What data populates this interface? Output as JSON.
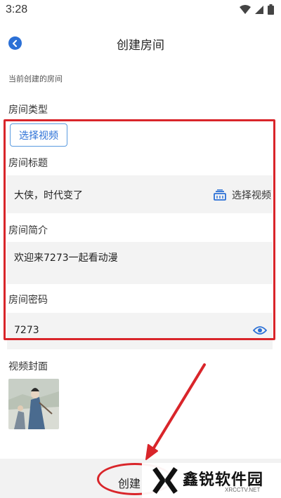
{
  "status": {
    "time": "3:28"
  },
  "header": {
    "title": "创建房间"
  },
  "section_hint": "当前创建的房间",
  "room_type": {
    "label": "房间类型",
    "button": "选择视频"
  },
  "room_title": {
    "label": "房间标题",
    "value": "大侠，时代变了",
    "action": "选择视频"
  },
  "room_intro": {
    "label": "房间简介",
    "value": "欢迎来7273一起看动漫"
  },
  "room_password": {
    "label": "房间密码",
    "value": "7273"
  },
  "cover": {
    "label": "视频封面"
  },
  "footer": {
    "create_label": "创建"
  },
  "watermark": {
    "brand": "鑫锐软件园",
    "site": "XRCCTV.NET"
  },
  "colors": {
    "accent": "#2b70d6",
    "highlight": "#d9252a",
    "field_bg": "#f3f3f3"
  }
}
